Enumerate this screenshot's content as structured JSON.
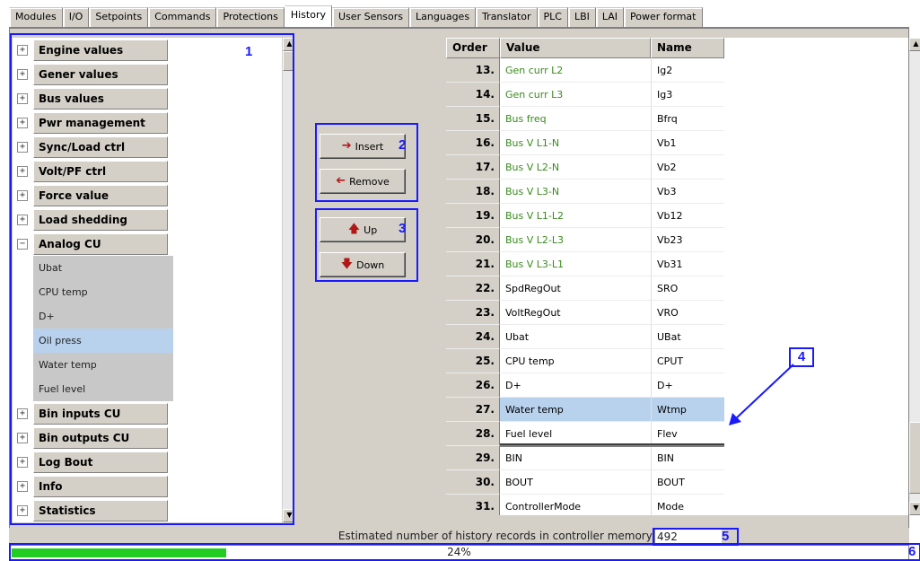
{
  "tabs": [
    "Modules",
    "I/O",
    "Setpoints",
    "Commands",
    "Protections",
    "History",
    "User Sensors",
    "Languages",
    "Translator",
    "PLC",
    "LBI",
    "LAI",
    "Power format"
  ],
  "active_tab": "History",
  "tree": {
    "groups_top": [
      {
        "label": "Engine values",
        "toggle": "+"
      },
      {
        "label": "Gener values",
        "toggle": "+"
      },
      {
        "label": "Bus values",
        "toggle": "+"
      },
      {
        "label": "Pwr management",
        "toggle": "+"
      },
      {
        "label": "Sync/Load ctrl",
        "toggle": "+"
      },
      {
        "label": "Volt/PF ctrl",
        "toggle": "+"
      },
      {
        "label": "Force value",
        "toggle": "+"
      },
      {
        "label": "Load shedding",
        "toggle": "+"
      },
      {
        "label": "Analog CU",
        "toggle": "−"
      }
    ],
    "analog_cu_items": [
      "Ubat",
      "CPU temp",
      "D+",
      "Oil press",
      "Water temp",
      "Fuel level"
    ],
    "selected_item": "Oil press",
    "groups_bottom": [
      {
        "label": "Bin inputs CU",
        "toggle": "+"
      },
      {
        "label": "Bin outputs CU",
        "toggle": "+"
      },
      {
        "label": "Log Bout",
        "toggle": "+"
      },
      {
        "label": "Info",
        "toggle": "+"
      },
      {
        "label": "Statistics",
        "toggle": "+"
      }
    ]
  },
  "buttons": {
    "insert": "Insert",
    "remove": "Remove",
    "up": "Up",
    "down": "Down"
  },
  "table": {
    "headers": {
      "order": "Order",
      "value": "Value",
      "name": "Name"
    },
    "rows": [
      {
        "order": "13.",
        "value": "Gen curr L2",
        "name": "Ig2",
        "green": true
      },
      {
        "order": "14.",
        "value": "Gen curr L3",
        "name": "Ig3",
        "green": true
      },
      {
        "order": "15.",
        "value": "Bus freq",
        "name": "Bfrq",
        "green": true
      },
      {
        "order": "16.",
        "value": "Bus V L1-N",
        "name": "Vb1",
        "green": true
      },
      {
        "order": "17.",
        "value": "Bus V L2-N",
        "name": "Vb2",
        "green": true
      },
      {
        "order": "18.",
        "value": "Bus V L3-N",
        "name": "Vb3",
        "green": true
      },
      {
        "order": "19.",
        "value": "Bus V L1-L2",
        "name": "Vb12",
        "green": true
      },
      {
        "order": "20.",
        "value": "Bus V L2-L3",
        "name": "Vb23",
        "green": true
      },
      {
        "order": "21.",
        "value": "Bus V L3-L1",
        "name": "Vb31",
        "green": true
      },
      {
        "order": "22.",
        "value": "SpdRegOut",
        "name": "SRO",
        "green": false
      },
      {
        "order": "23.",
        "value": "VoltRegOut",
        "name": "VRO",
        "green": false
      },
      {
        "order": "24.",
        "value": "Ubat",
        "name": "UBat",
        "green": false
      },
      {
        "order": "25.",
        "value": "CPU temp",
        "name": "CPUT",
        "green": false
      },
      {
        "order": "26.",
        "value": "D+",
        "name": "D+",
        "green": false
      },
      {
        "order": "27.",
        "value": "Water temp",
        "name": "Wtmp",
        "green": false
      },
      {
        "order": "28.",
        "value": "Fuel level",
        "name": "Flev",
        "green": false
      },
      {
        "order": "29.",
        "value": "BIN",
        "name": "BIN",
        "green": false
      },
      {
        "order": "30.",
        "value": "BOUT",
        "name": "BOUT",
        "green": false
      },
      {
        "order": "31.",
        "value": "ControllerMode",
        "name": "Mode",
        "green": false
      }
    ],
    "selected_order": "27."
  },
  "status": {
    "label": "Estimated number of history records in controller memory:",
    "value": "492"
  },
  "progress": {
    "text": "24%",
    "fraction": 0.24
  },
  "callouts": [
    "1",
    "2",
    "3",
    "4",
    "5",
    "6"
  ],
  "colors": {
    "callout": "#1a1aff",
    "green_value": "#3a8a1e",
    "selection": "#b8d2ee",
    "progress_fill": "#22cc22",
    "arrow_red": "#b01818"
  }
}
